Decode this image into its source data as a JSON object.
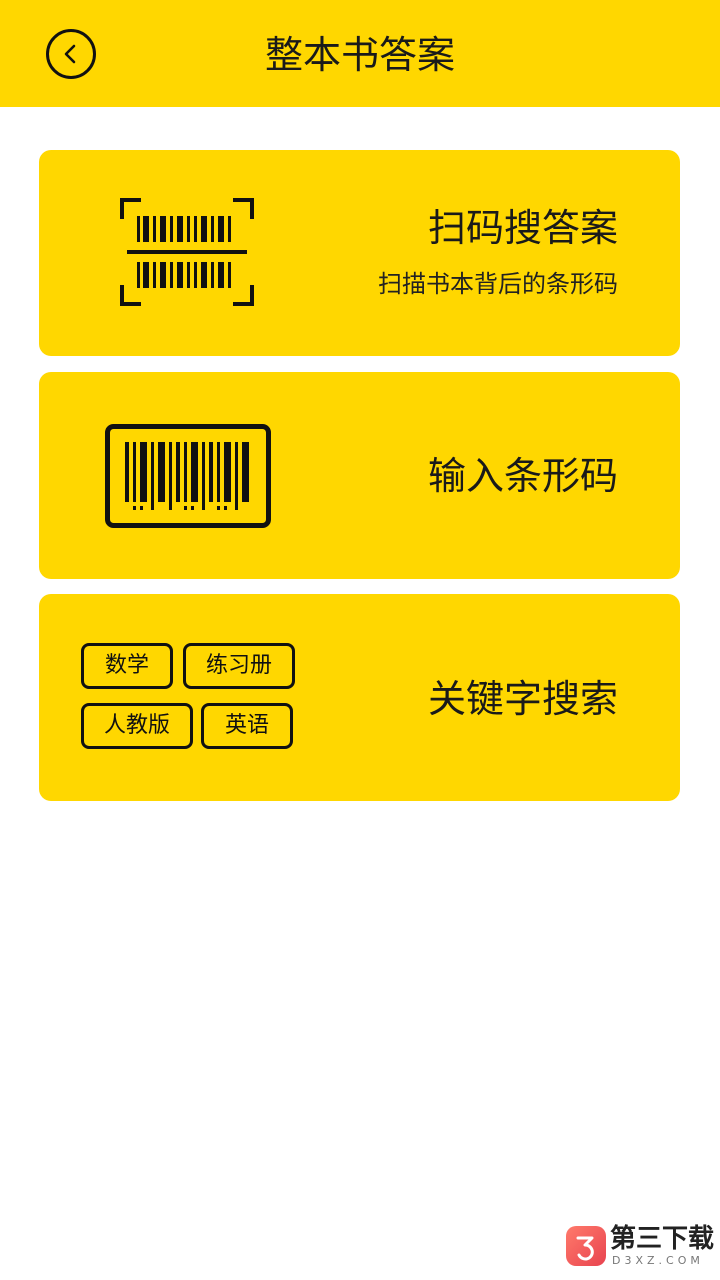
{
  "header": {
    "title": "整本书答案",
    "back_icon": "chevron-left-icon"
  },
  "cards": [
    {
      "title": "扫码搜答案",
      "subtitle": "扫描书本背后的条形码",
      "icon": "barcode-scan-icon"
    },
    {
      "title": "输入条形码",
      "icon": "barcode-icon"
    },
    {
      "title": "关键字搜索",
      "tags": [
        "数学",
        "练习册",
        "人教版",
        "英语"
      ]
    }
  ],
  "watermark": {
    "name": "第三下载",
    "domain": "D3XZ.COM"
  },
  "colors": {
    "accent": "#FFD700",
    "background": "#FFFFFF",
    "text": "#1A1A1A"
  }
}
